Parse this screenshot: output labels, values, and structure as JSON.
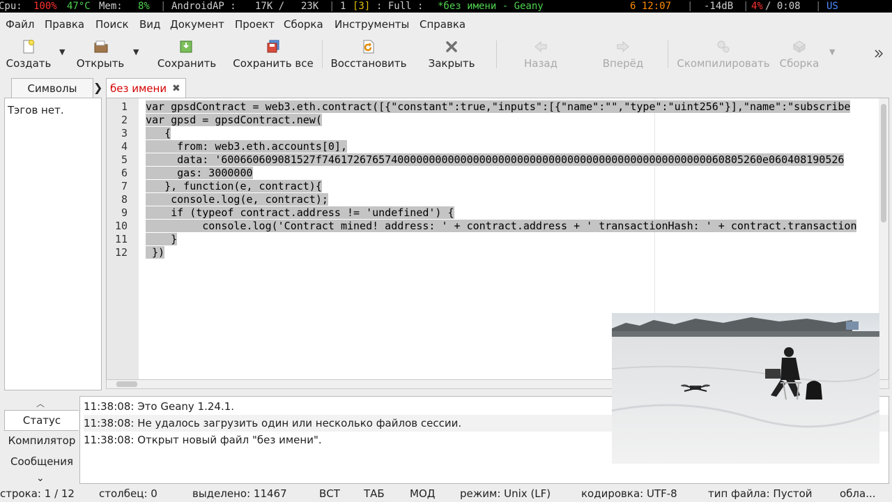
{
  "topbar": {
    "cpu_label": "Cpu:",
    "cpu_value": "100%",
    "temp": "47°C",
    "mem_label": "Mem:",
    "mem_value": "8%",
    "wifi_name": "AndroidAP :",
    "net_down": "17K /",
    "net_up": "23K",
    "workspace": "1",
    "workspace_active": "[3]",
    "layout": ": Full :",
    "window_title": "*без имени - Geany",
    "clock": "6 12:07",
    "volume": "-14dB",
    "battery_pct": "4%",
    "battery_time": "/ 0:08",
    "kbd": "US",
    "colors": {
      "red": "#ff3030",
      "green": "#4fd14f",
      "yellow": "#e0c000",
      "orange": "#ff8a00",
      "blue": "#4a8cff"
    }
  },
  "menubar": {
    "items": [
      "Файл",
      "Правка",
      "Поиск",
      "Вид",
      "Документ",
      "Проект",
      "Сборка",
      "Инструменты",
      "Справка"
    ]
  },
  "toolbar": {
    "new": "Создать",
    "open": "Открыть",
    "save": "Сохранить",
    "save_all": "Сохранить все",
    "revert": "Восстановить",
    "close": "Закрыть",
    "back": "Назад",
    "forward": "Вперёд",
    "compile": "Скомпилировать",
    "build": "Сборка"
  },
  "sidebar": {
    "tab_label": "Символы",
    "empty_text": "Тэгов нет."
  },
  "editor": {
    "tab_name": "без имени",
    "tab_close": "✖",
    "line_numbers": [
      "1",
      "2",
      "3",
      "4",
      "5",
      "6",
      "7",
      "8",
      "9",
      "10",
      "11",
      "12"
    ],
    "lines": [
      "var gpsdContract = web3.eth.contract([{\"constant\":true,\"inputs\":[{\"name\":\"\",\"type\":\"uint256\"}],\"name\":\"subscribe",
      "var gpsd = gpsdContract.new(",
      "   {",
      "     from: web3.eth.accounts[0],",
      "     data: '600660609081527f7461726765740000000000000000000000000000000000000000000000000060805260e060408190526",
      "     gas: 3000000",
      "   }, function(e, contract){",
      "    console.log(e, contract);",
      "    if (typeof contract.address != 'undefined') {",
      "         console.log('Contract mined! address: ' + contract.address + ' transactionHash: ' + contract.transaction",
      "    }",
      " })"
    ]
  },
  "messages": {
    "tabs": [
      "Статус",
      "Компилятор",
      "Сообщения"
    ],
    "lines": [
      "11:38:08: Это Geany 1.24.1.",
      "11:38:08: Не удалось загрузить один или несколько файлов сессии.",
      "11:38:08: Открыт новый файл \"без имени\"."
    ]
  },
  "statusbar": {
    "line": "строка: 1 / 12",
    "col": "столбец: 0",
    "selected": "выделено: 11467",
    "ins": "ВСТ",
    "tab": "ТАБ",
    "mod": "МОД",
    "mode": "режим: Unix (LF)",
    "encoding": "кодировка: UTF-8",
    "filetype": "тип файла: Пустой",
    "scope": "обла..."
  }
}
